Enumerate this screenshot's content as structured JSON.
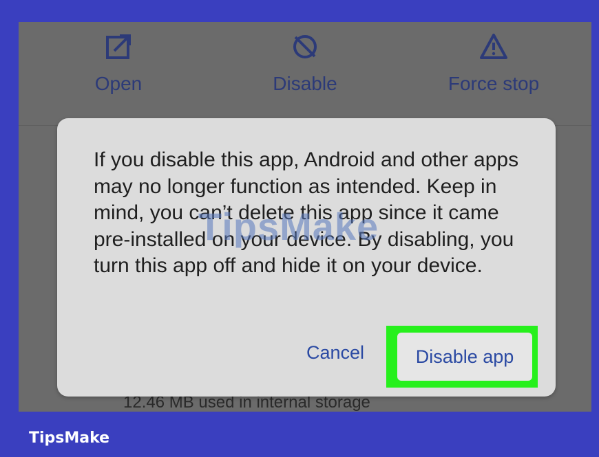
{
  "app_settings": {
    "actions": [
      {
        "label": "Open",
        "icon": "open-external-icon"
      },
      {
        "label": "Disable",
        "icon": "disable-circle-icon"
      },
      {
        "label": "Force stop",
        "icon": "warning-triangle-icon"
      }
    ],
    "storage_text": "12.46 MB used in internal storage"
  },
  "dialog": {
    "message": "If you disable this app, Android and other apps may no longer function as intended. Keep in mind, you can’t delete this app since it came pre-installed on your device. By disabling, you turn this app off and hide it on your device.",
    "cancel_label": "Cancel",
    "disable_label": "Disable app"
  },
  "overlay": {
    "watermark": "TipsMake",
    "brand": "TipsMake"
  },
  "colors": {
    "frame": "#3a3fbf",
    "highlight": "#26f01c",
    "button_text": "#2b4aa3"
  }
}
